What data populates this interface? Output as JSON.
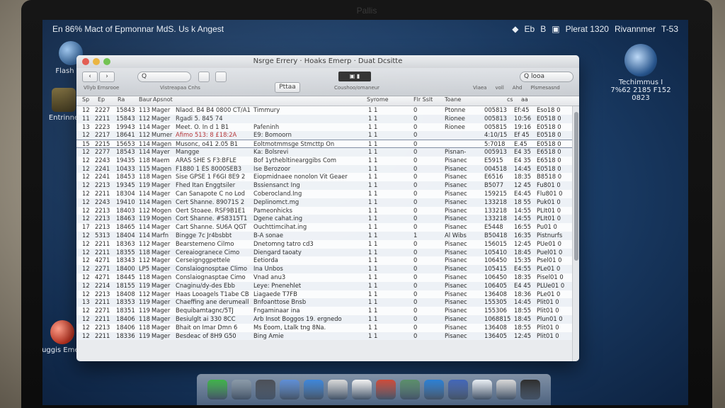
{
  "monitor": {
    "brand": "Pallis"
  },
  "menubar": {
    "left_text": "En 86% Mact of Epmonnar MdS. Us k Angest",
    "right_items": [
      "◆",
      "Eb",
      "B",
      "▣",
      "Plerat 1320",
      "Rivannmer",
      "T-53"
    ]
  },
  "desktop_icons": [
    {
      "label": "Flash Hu",
      "style": "blue"
    },
    {
      "label": "Entrinne",
      "style": "box"
    },
    {
      "label": "Buggis Emeea",
      "style": "red"
    },
    {
      "label": "Techimmus Ⅰ 7%62 2185 F152 0823",
      "style": "globe"
    }
  ],
  "window": {
    "title": "Nsrge Errery · Hoaks Emerp · Duat Dcsitte",
    "toolbar": {
      "back_label": "‹",
      "forward_label": "›",
      "search_left_placeholder": "Q",
      "view_label": "Vllyb Ernsrooe",
      "view2_label": "Vistreapaa Cnhs",
      "lcd_text": "▣ ▮",
      "center_label": "Pttaa",
      "center_sub": "Coushoo/omaneur",
      "search_right_placeholder": "Q looa",
      "right_labels": [
        "Viaea",
        "voll",
        "Ahd",
        "Plsmesasnd"
      ]
    },
    "columns": [
      "Sp",
      "Ep",
      "Ra",
      "Baur",
      "Apsnot",
      "",
      "Syrome",
      "Flr Sslt",
      "Toane",
      "cs",
      "aa"
    ],
    "rows": [
      {
        "n": "12",
        "d": "2227",
        "c": "15843",
        "k": "113",
        "a": "Mager",
        "title": "Nlaod. B4 B4 0800 CT/A1",
        "note": "Timmury",
        "s": "1 1",
        "f": "0",
        "t": "Ptonne",
        "id": "005813",
        "x": "Ef:45",
        "v": "Eso18 0"
      },
      {
        "n": "11",
        "d": "2211",
        "c": "15843",
        "k": "112",
        "a": "Mager",
        "title": "Rgadi 5. 845 74",
        "note": "",
        "s": "1 1",
        "f": "0",
        "t": "Rionee",
        "id": "005813",
        "x": "10:56",
        "v": "E0518 0"
      },
      {
        "n": "13",
        "d": "2223",
        "c": "19943",
        "k": "114",
        "a": "Mager",
        "title": "Meet. O. In d 1 B1",
        "note": "Pafeninh",
        "s": "1 1",
        "f": "0",
        "t": "Rionee",
        "id": "005815",
        "x": "19:16",
        "v": "E0518 0"
      },
      {
        "n": "12",
        "d": "2217",
        "c": "18641",
        "k": "112",
        "a": "Mumer",
        "title": "Afimo 513: 8 £18:2A",
        "note": "E9: Bomoorn",
        "s": "1 1",
        "f": "0",
        "t": "",
        "id": "4:10/15",
        "x": "Ef 45",
        "v": "E0518 0",
        "flag": true
      },
      {
        "n": "15",
        "d": "2215",
        "c": "15653",
        "k": "114",
        "a": "Magen",
        "title": "Musonc, o41 2.05 B1",
        "note": "Eoltmotmmsge Stmcttp On",
        "s": "1 1",
        "f": "0",
        "t": "",
        "id": "5:7018",
        "x": "E.45",
        "v": "E0518 0",
        "sel": true
      },
      {
        "n": "12",
        "d": "2277",
        "c": "18543",
        "k": "114",
        "a": "Mayer",
        "title": "Mangge",
        "note": "Ka: Bolsrevi",
        "s": "1 1",
        "f": "0",
        "t": "Pisnan-",
        "id": "005913",
        "x": "E4 35",
        "v": "E6518 0"
      },
      {
        "n": "12",
        "d": "2243",
        "c": "19435",
        "k": "118",
        "a": "Maem",
        "title": "ARAS SHE S F3:BFLE",
        "note": "Bof 1ythebltinearggibs Com",
        "s": "1 1",
        "f": "0",
        "t": "Pisanec",
        "id": "E5915",
        "x": "E4 35",
        "v": "E6518 0"
      },
      {
        "n": "12",
        "d": "2241",
        "c": "10433",
        "k": "115",
        "a": "Magen",
        "title": "F1880 1 ÉS 8000SEB3",
        "note": "Ise Berozoor",
        "s": "1 1",
        "f": "0",
        "t": "Pisanec",
        "id": "004518",
        "x": "14:45",
        "v": "E0518 0"
      },
      {
        "n": "12",
        "d": "2241",
        "c": "18453",
        "k": "118",
        "a": "Magen",
        "title": "Sise GPSE 1 F6GI 8E9 2",
        "note": "Eiopmidnaee nonolon Vit Geaer",
        "s": "1 1",
        "f": "0",
        "t": "Pisanec",
        "id": "E6516",
        "x": "18:35",
        "v": "B8518 0"
      },
      {
        "n": "12",
        "d": "2213",
        "c": "19345",
        "k": "119",
        "a": "Mager",
        "title": "Fhed Itan Enggtsiler",
        "note": "Bssiensanct Ing",
        "s": "1 1",
        "f": "0",
        "t": "Pisanec",
        "id": "B5077",
        "x": "12 45",
        "v": "Fu801 0"
      },
      {
        "n": "12",
        "d": "2211",
        "c": "18304",
        "k": "114",
        "a": "Mager",
        "title": "Can Sanapote C no Lod",
        "note": "Coberocland.Ing",
        "s": "1 1",
        "f": "0",
        "t": "Pisanec",
        "id": "159215",
        "x": "E4:45",
        "v": "Flu801 0"
      },
      {
        "n": "12",
        "d": "2243",
        "c": "19410",
        "k": "114",
        "a": "Magen",
        "title": "Cert Shanne. 89071S 2",
        "note": "Deplinomct.mg",
        "s": "1 1",
        "f": "0",
        "t": "Pisanec",
        "id": "133218",
        "x": "18 55",
        "v": "Puk01 0"
      },
      {
        "n": "12",
        "d": "2213",
        "c": "18403",
        "k": "112",
        "a": "Mogen",
        "title": "Oert Stoaee. RSF9B1E1",
        "note": "Pameonhicks",
        "s": "1 1",
        "f": "0",
        "t": "Pisanec",
        "id": "133218",
        "x": "14:55",
        "v": "PLIt01 0"
      },
      {
        "n": "12",
        "d": "2213",
        "c": "18463",
        "k": "119",
        "a": "Mogen",
        "title": "Cort Shanne. #S8315T1",
        "note": "Dgene cahat.ing",
        "s": "1 1",
        "f": "0",
        "t": "Pisanec",
        "id": "133218",
        "x": "14:55",
        "v": "PLIt01 0"
      },
      {
        "n": "17",
        "d": "2213",
        "c": "18465",
        "k": "114",
        "a": "Mager",
        "title": "Cart Shanne. SU6A QGT",
        "note": "Ouchttimcihat.ing",
        "s": "1 1",
        "f": "0",
        "t": "Pisanec",
        "id": "E5448",
        "x": "16:55",
        "v": "Pu01 0"
      },
      {
        "n": "12",
        "d": "5313",
        "c": "18404",
        "k": "114",
        "a": "Marfn",
        "title": "Bingge 7c Jr4bsbbt",
        "note": "B-A sonae",
        "s": "1 1",
        "f": "1",
        "t": "Al Wibs",
        "id": "B50418",
        "x": "16:35",
        "v": "Pistnurfs"
      },
      {
        "n": "12",
        "d": "2211",
        "c": "18363",
        "k": "112",
        "a": "Mager",
        "title": "Bearstemeno Cilmo",
        "note": "Dnetomng tatro cd3",
        "s": "1 1",
        "f": "0",
        "t": "Pisanec",
        "id": "156015",
        "x": "12:45",
        "v": "PUe01 0"
      },
      {
        "n": "12",
        "d": "2211",
        "c": "18355",
        "k": "118",
        "a": "Mager",
        "title": "Cereaiogranece Cimo",
        "note": "Diengard taoaty",
        "s": "1 1",
        "f": "0",
        "t": "Pisanec",
        "id": "105410",
        "x": "18:45",
        "v": "Puel01 0"
      },
      {
        "n": "12",
        "d": "4271",
        "c": "18343",
        "k": "112",
        "a": "Mager",
        "title": "Cerseignggpettele",
        "note": "Eetiorda",
        "s": "1 1",
        "f": "0",
        "t": "Pisanec",
        "id": "106450",
        "x": "15:35",
        "v": "Psel01 0"
      },
      {
        "n": "12",
        "d": "2271",
        "c": "18400",
        "k": "LP5",
        "a": "Mager",
        "title": "Conslaiognosptae Climo",
        "note": "Ina Unbos",
        "s": "1 1",
        "f": "0",
        "t": "Pisanec",
        "id": "105415",
        "x": "E4:55",
        "v": "PLe01 0"
      },
      {
        "n": "12",
        "d": "4271",
        "c": "18445",
        "k": "118",
        "a": "Magen",
        "title": "Conslaiognasptae Cimo",
        "note": "Vnad anu3",
        "s": "1 1",
        "f": "0",
        "t": "Pisanec",
        "id": "106450",
        "x": "18:35",
        "v": "Pisel01 0"
      },
      {
        "n": "12",
        "d": "2214",
        "c": "18155",
        "k": "119",
        "a": "Mager",
        "title": "Cnaginu/dy-des Ebb",
        "note": "Leye: Pnenehlet",
        "s": "1 1",
        "f": "0",
        "t": "Pisanec",
        "id": "106405",
        "x": "E4 45",
        "v": "PLUe01 0"
      },
      {
        "n": "12",
        "d": "2213",
        "c": "18408",
        "k": "112",
        "a": "Mager",
        "title": "Haas Looagels T1abe CB",
        "note": "Liagaede T7FB",
        "s": "1 1",
        "f": "0",
        "t": "Pisanec",
        "id": "136408",
        "x": "18:36",
        "v": "PLe01 0"
      },
      {
        "n": "13",
        "d": "2211",
        "c": "18353",
        "k": "119",
        "a": "Mager",
        "title": "Chaeffing ane derumeall",
        "note": "Bnfoanttose Bnsb",
        "s": "1 1",
        "f": "0",
        "t": "Pisanec",
        "id": "155305",
        "x": "14:45",
        "v": "Plit01 0"
      },
      {
        "n": "12",
        "d": "2271",
        "c": "18351",
        "k": "119",
        "a": "Mager",
        "title": "Bequibamtagnc/5TJ",
        "note": "Fngaminaar ina",
        "s": "1 1",
        "f": "0",
        "t": "Pisanec",
        "id": "155306",
        "x": "18:55",
        "v": "Plit01 0"
      },
      {
        "n": "12",
        "d": "2211",
        "c": "18406",
        "k": "118",
        "a": "Mager",
        "title": "Besiulglt ai 330 8CC",
        "note": "Arb Insot Boggos 19. ergnedo",
        "s": "1 1",
        "f": "0",
        "t": "Pisanec",
        "id": "1068815",
        "x": "18:45",
        "v": "Plun01 0"
      },
      {
        "n": "12",
        "d": "2213",
        "c": "18406",
        "k": "118",
        "a": "Mager",
        "title": "Bhait on Imar Dmn 6",
        "note": "Ms Eoom, Ltalk tng 8Na.",
        "s": "1 1",
        "f": "0",
        "t": "Pisanec",
        "id": "136408",
        "x": "18:55",
        "v": "Plit01 0"
      },
      {
        "n": "12",
        "d": "2211",
        "c": "18336",
        "k": "119",
        "a": "Mager",
        "title": "Besdeac of 8H9 G50",
        "note": "Bing Amie",
        "s": "1 1",
        "f": "0",
        "t": "Pisanec",
        "id": "136405",
        "x": "12:45",
        "v": "Plit01 0"
      }
    ]
  },
  "dock": {
    "colors": [
      "#3fb24a",
      "#8a9aa8",
      "#4b4f57",
      "#5e8ed6",
      "#3d86d9",
      "#d8d8d8",
      "#f2f2f2",
      "#cc4b3a",
      "#5a8e6a",
      "#2b7fd3",
      "#4266b8",
      "#e9eef4",
      "#d8d8d8",
      "#2d2d2d"
    ]
  }
}
